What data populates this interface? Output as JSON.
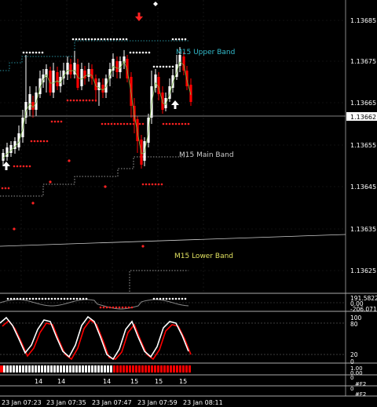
{
  "main_price_axis": {
    "labels": [
      "1.13685",
      "1.13675",
      "1.13665",
      "1.13655",
      "1.13645",
      "1.13635",
      "1.13625"
    ],
    "current_price": "1.13662"
  },
  "band_labels": {
    "upper": "M15 Upper Band",
    "main": "M15 Main Band",
    "lower": "M15 Lower Band"
  },
  "cci_panel": {
    "labels": [
      "191.5822",
      "0.00",
      "-206.0715"
    ]
  },
  "stoch_panel": {
    "labels": [
      "100",
      "80",
      "20",
      "0"
    ]
  },
  "histogram_panel": {
    "labels": [
      "1.00",
      "0.00"
    ]
  },
  "small_panel": {
    "labels": [
      "0",
      "#F2"
    ]
  },
  "bottom_panel": {
    "labels": [
      "0",
      "#F2"
    ]
  },
  "panel_row_labels": [
    "14",
    "14",
    "14",
    "15",
    "15",
    "15"
  ],
  "time_axis": [
    "23 Jan 07:23",
    "23 Jan 07:35",
    "23 Jan 07:47",
    "23 Jan 07:59",
    "23 Jan 08:11"
  ],
  "colors": {
    "background": "#000000",
    "bull_candle": "#ffffff",
    "bear_candle": "#ff0000",
    "grid": "#2a2a2a",
    "upper_band_text": "#33bbcc",
    "main_band_text": "#cccccc",
    "lower_band_text": "#e0e060",
    "ma_line": "#7ab648",
    "stoch_main": "#ffffff",
    "stoch_signal": "#ff0000"
  }
}
